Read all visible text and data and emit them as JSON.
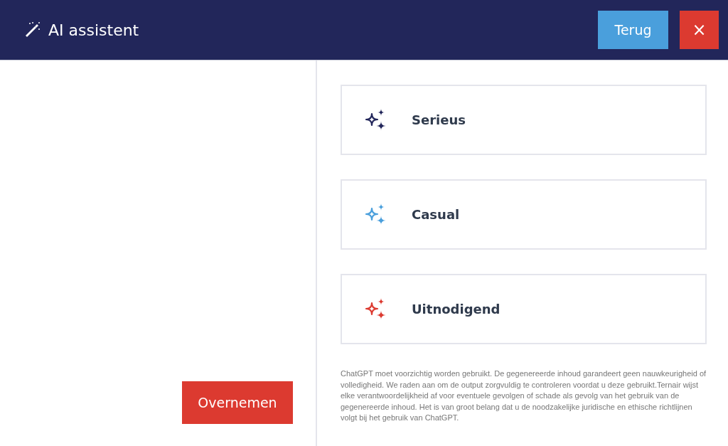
{
  "header": {
    "title": "AI assistent",
    "back_button": "Terug",
    "close_button": "×"
  },
  "options": [
    {
      "label": "Serieus",
      "color": "#22265a"
    },
    {
      "label": "Casual",
      "color": "#4a9fdc"
    },
    {
      "label": "Uitnodigend",
      "color": "#dc3a30"
    }
  ],
  "disclaimer": "ChatGPT moet voorzichtig worden gebruikt. De gegenereerde inhoud garandeert geen nauwkeurigheid of volledigheid. We raden aan om de output zorgvuldig te controleren voordat u deze gebruikt.Ternair wijst elke verantwoordelijkheid af voor eventuele gevolgen of schade als gevolg van het gebruik van de gegenereerde inhoud. Het is van groot belang dat u de noodzakelijke juridische en ethische richtlijnen volgt bij het gebruik van ChatGPT.",
  "apply_button": "Overnemen"
}
